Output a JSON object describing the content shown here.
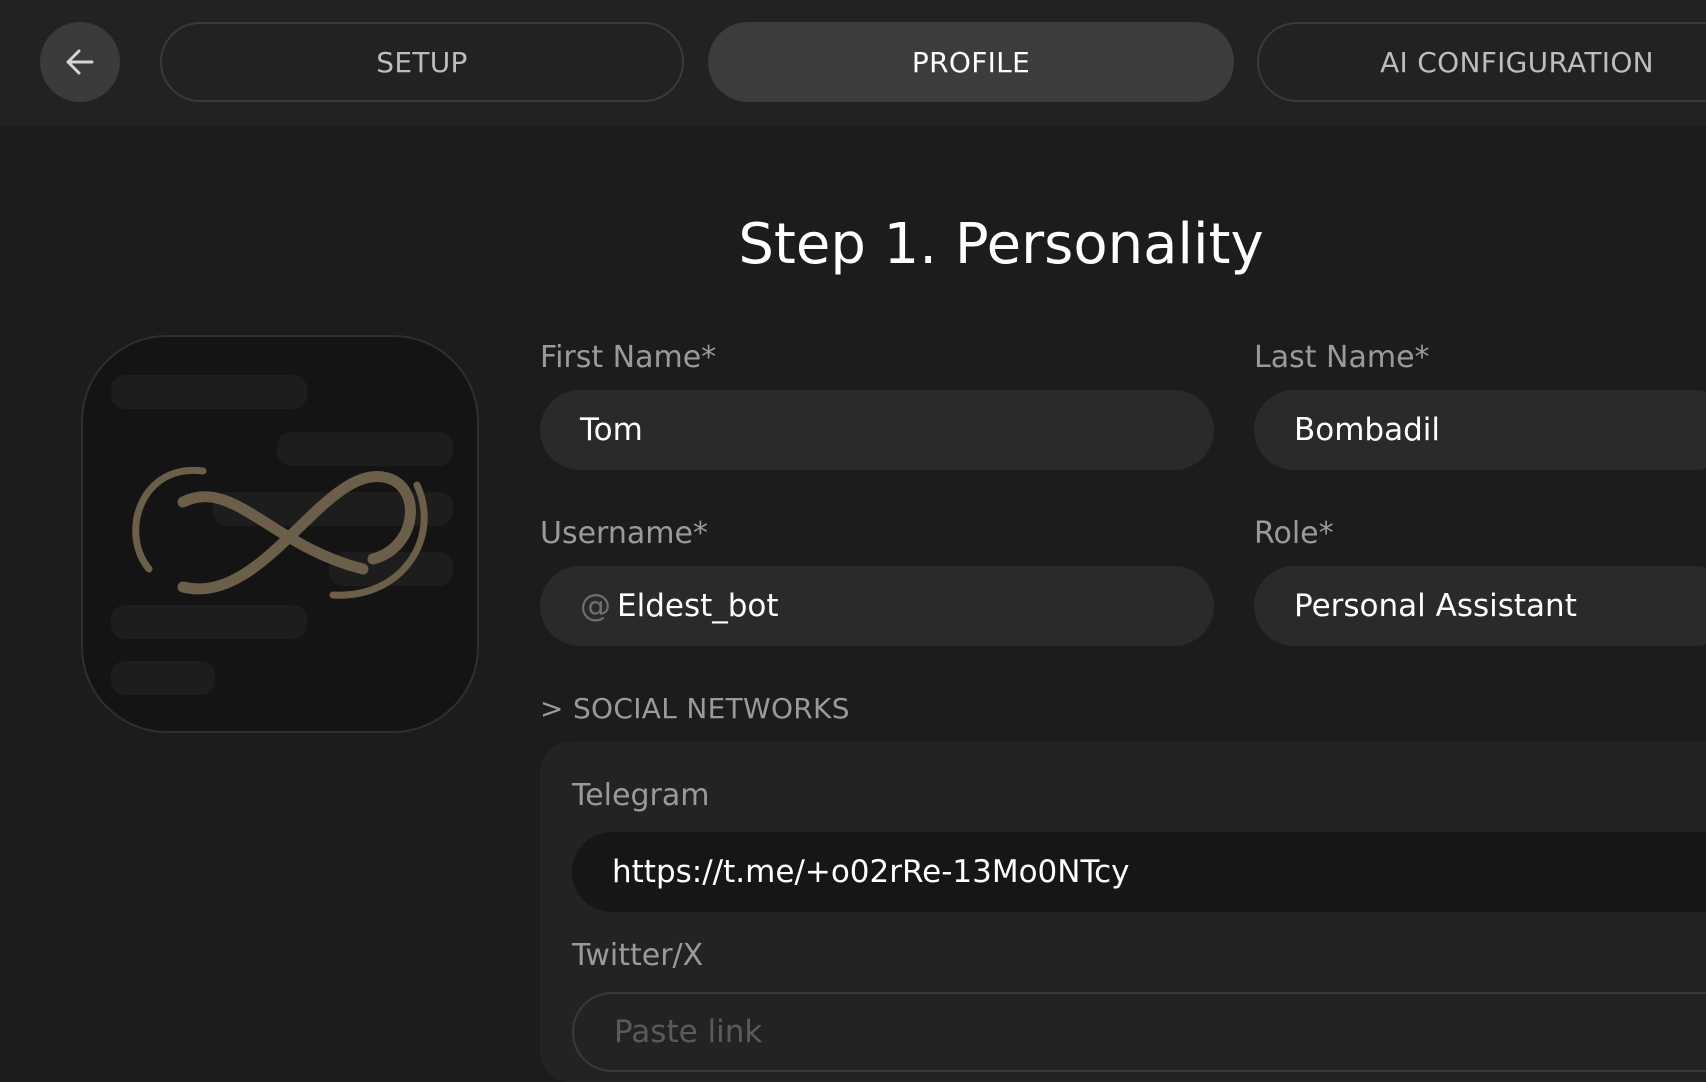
{
  "tabs": [
    {
      "label": "SETUP",
      "active": false
    },
    {
      "label": "PROFILE",
      "active": true
    },
    {
      "label": "AI CONFIGURATION",
      "active": false
    }
  ],
  "page": {
    "title": "Step 1. Personality"
  },
  "avatar": {
    "icon": "infinity-logo-icon"
  },
  "form": {
    "first_name": {
      "label": "First Name*",
      "value": "Tom"
    },
    "last_name": {
      "label": "Last Name*",
      "value": "Bombadil"
    },
    "username": {
      "label": "Username*",
      "prefix": "@",
      "value": "Eldest_bot"
    },
    "role": {
      "label": "Role*",
      "value": "Personal Assistant"
    }
  },
  "social": {
    "toggle_label": "> SOCIAL NETWORKS",
    "telegram": {
      "label": "Telegram",
      "value": "https://t.me/+o02rRe-13Mo0NTcy"
    },
    "twitter": {
      "label": "Twitter/X",
      "placeholder": "Paste link"
    }
  },
  "colors": {
    "background": "#1c1c1c",
    "topbar": "#222222",
    "field": "#2a2a2a",
    "logo_gold": "#6b5f49"
  }
}
